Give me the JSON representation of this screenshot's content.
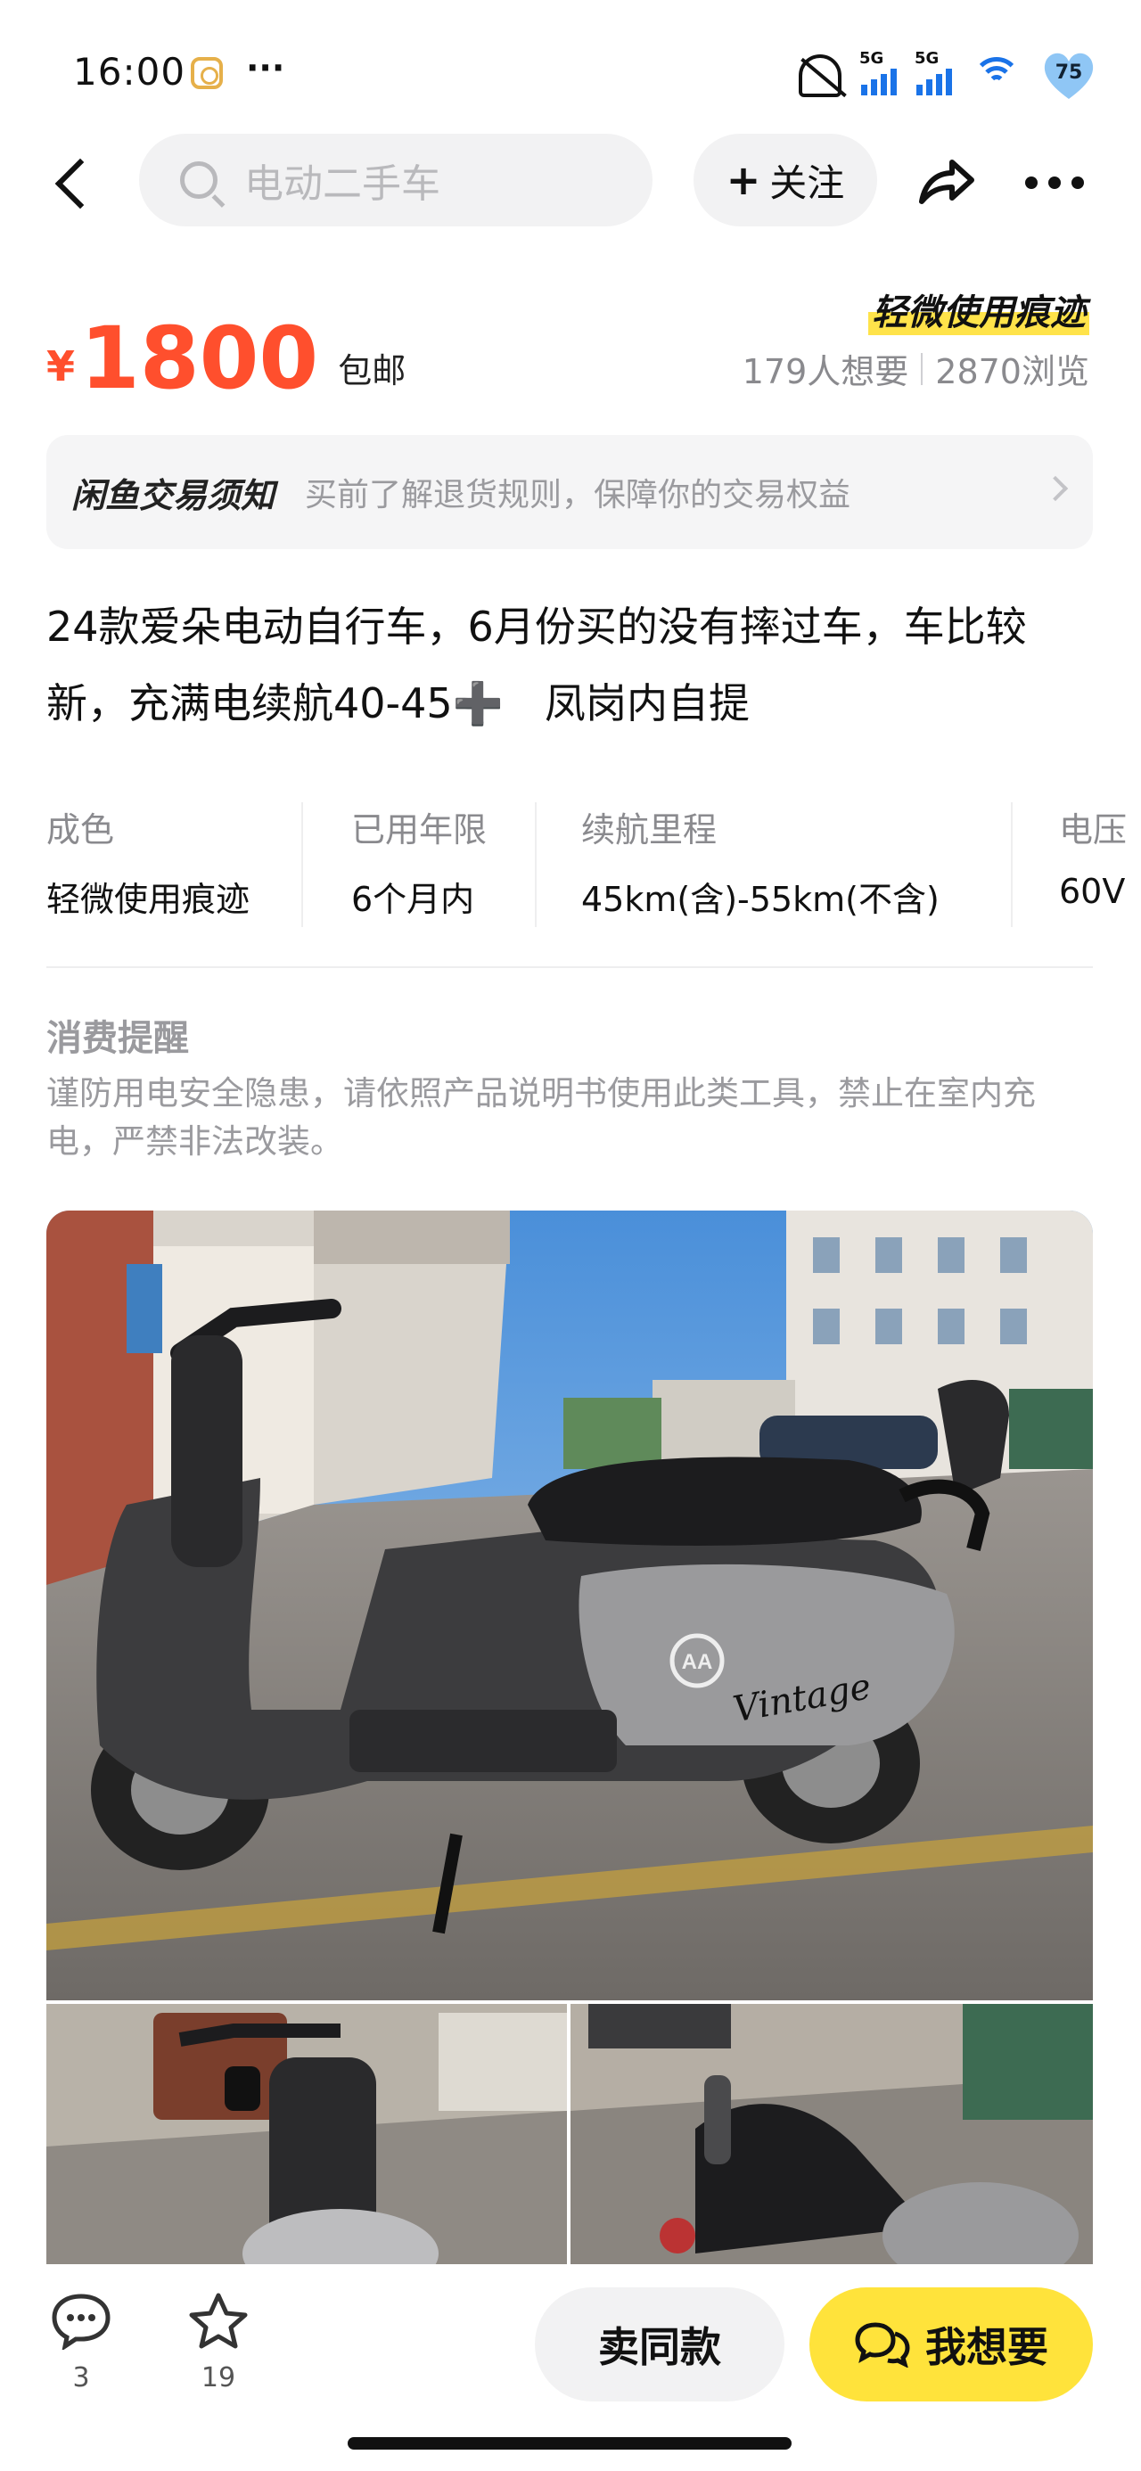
{
  "status_bar": {
    "time": "16:00",
    "dots": "···",
    "network_tag_1": "5G",
    "network_tag_2": "5G",
    "battery_level": "75"
  },
  "nav": {
    "search_placeholder": "电动二手车",
    "follow_label": "关注",
    "follow_plus": "+"
  },
  "price": {
    "currency": "¥",
    "amount": "1800",
    "shipping": "包邮"
  },
  "condition_badge": "轻微使用痕迹",
  "stats": {
    "wants": "179人想要",
    "views": "2870浏览"
  },
  "notice": {
    "title": "闲鱼交易须知",
    "text": "买前了解退货规则，保障你的交易权益"
  },
  "description": "24款爱朵电动自行车，6月份买的没有摔过车，车比较新，充满电续航40-45➕　凤岗内自提",
  "specs": [
    {
      "label": "成色",
      "value": "轻微使用痕迹"
    },
    {
      "label": "已用年限",
      "value": "6个月内"
    },
    {
      "label": "续航里程",
      "value": "45km(含)-55km(不含)"
    },
    {
      "label": "电压",
      "value": "60V"
    }
  ],
  "reminder": {
    "title": "消费提醒",
    "text": "谨防用电安全隐患，请依照产品说明书使用此类工具，禁止在室内充电，严禁非法改装。"
  },
  "photo_text": {
    "brand_script": "Vintage",
    "logo": "AA"
  },
  "bottom_bar": {
    "comments_count": "3",
    "favorites_count": "19",
    "sell_same_label": "卖同款",
    "want_label": "我想要"
  },
  "colors": {
    "price": "#ff4f2d",
    "accent_yellow": "#ffe33b",
    "muted_text": "#9a9a9e"
  }
}
